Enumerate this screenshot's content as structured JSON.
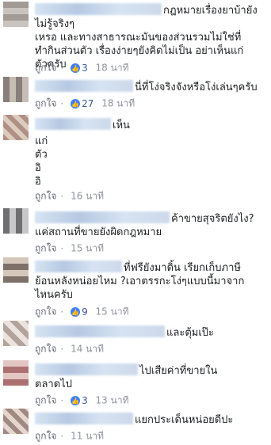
{
  "like_label": "ถูกใจ",
  "comments": [
    {
      "text_lines": [
        "กฎหมายเรื่องยาบ้ายังไม่รู้จริงๆ",
        "เหรอ และทางสาธารณะมันของส่วนรวมไม่ใช่ที่",
        "ทำกินส่วนตัว เรื่องง่ายๆยังคิดไม่เป็น อย่าเห็นแก่",
        "ตัวครับ"
      ],
      "likes": "3",
      "time": "18 นาที"
    },
    {
      "text_lines": [
        "นี่ที่โง่จริงจังหรือโง่เล่นๆครับ"
      ],
      "likes": "27",
      "time": "18 นาที"
    },
    {
      "text_lines": [
        "เห็น",
        "แก่",
        "ตัว",
        "อิ",
        "อิ"
      ],
      "likes": "",
      "time": "16 นาที"
    },
    {
      "text_lines": [
        "ค้าขายสุจริตยังไง?",
        "แค่สถานที่ขายยังผิดกฎหมาย"
      ],
      "likes": "",
      "time": "15 นาที"
    },
    {
      "text_lines": [
        "ที่ฟรียังมาดิ้น เรียกเก็บภาษี",
        "ย้อนหลังหน่อยไหม ?เอาตรรกะโง่ๆแบบนี้มาจาก",
        "ไหนครับ"
      ],
      "likes": "9",
      "time": "15 นาที"
    },
    {
      "text_lines": [
        "และตุ้มเป๊ะ"
      ],
      "likes": "",
      "time": "14 นาที"
    },
    {
      "text_lines": [
        "ไปเสียค่าที่ขายใน",
        "ตลาดไป"
      ],
      "likes": "3",
      "time": "13 นาที"
    },
    {
      "text_lines": [
        "แยกประเด็นหน่อยดีปะ"
      ],
      "likes": "",
      "time": "11 นาที"
    }
  ]
}
